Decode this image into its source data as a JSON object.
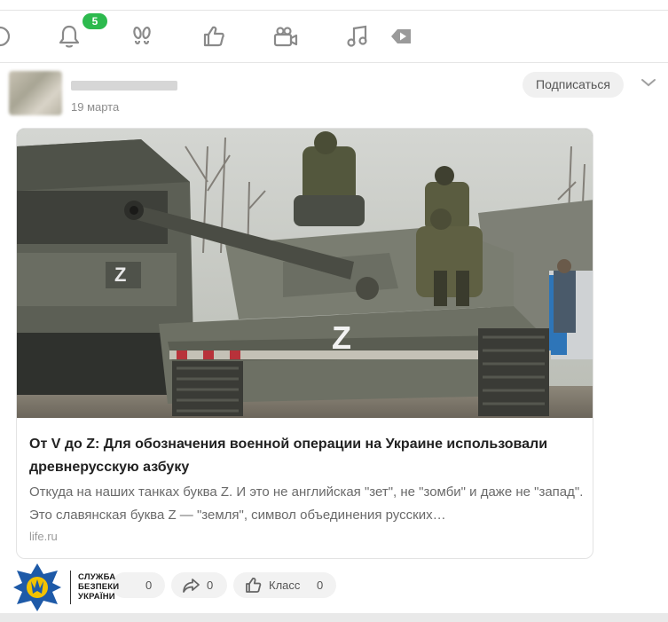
{
  "nav": {
    "notifications_badge": "5",
    "icons": [
      "messages-icon",
      "bell-icon",
      "footprints-icon",
      "like-icon",
      "video-camera-icon",
      "music-icon",
      "play-video-icon"
    ]
  },
  "post": {
    "date": "19 марта",
    "subscribe_label": "Подписаться"
  },
  "card": {
    "title": "От V до Z: Для обозначения военной операции на Украине использовали древнерусскую азбуку",
    "description": "Откуда на наших танках буква Z. И это не английская \"зет\", не \"зомби\" и даже не \"запад\". Это славянская буква Z — \"земля\", символ объединения русских…",
    "source": "life.ru",
    "image_alt": "tank-with-soldiers-photo"
  },
  "actions": {
    "comments_count": "0",
    "share_count": "0",
    "class_label": "Класс",
    "class_count": "0"
  },
  "watermark": {
    "line1": "СЛУЖБА",
    "line2": "БЕЗПЕКИ",
    "line3": "УКРАЇНИ"
  },
  "colors": {
    "badge": "#2dba4e",
    "sbu_blue": "#1e5aa8",
    "sbu_gold": "#f2c200"
  }
}
